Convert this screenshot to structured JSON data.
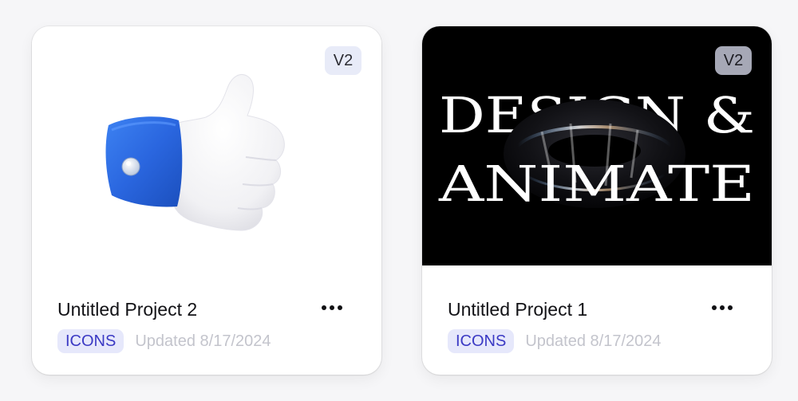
{
  "projects": [
    {
      "title": "Untitled Project 2",
      "version": "V2",
      "tag": "ICONS",
      "updated": "Updated 8/17/2024",
      "thumbnail": "thumbs-up-3d-illustration"
    },
    {
      "title": "Untitled Project 1",
      "version": "V2",
      "tag": "ICONS",
      "updated": "Updated 8/17/2024",
      "thumbnail": "design-and-animate-artwork",
      "artwork_text": [
        "DESIGN &",
        "ANIMATE"
      ]
    }
  ],
  "icons": {
    "more": "more-horizontal-icon"
  },
  "colors": {
    "tag_bg": "#e6e8fb",
    "tag_text": "#3b3ac4",
    "cuff_blue": "#2f6fe6",
    "dark_thumb": "#000000"
  }
}
